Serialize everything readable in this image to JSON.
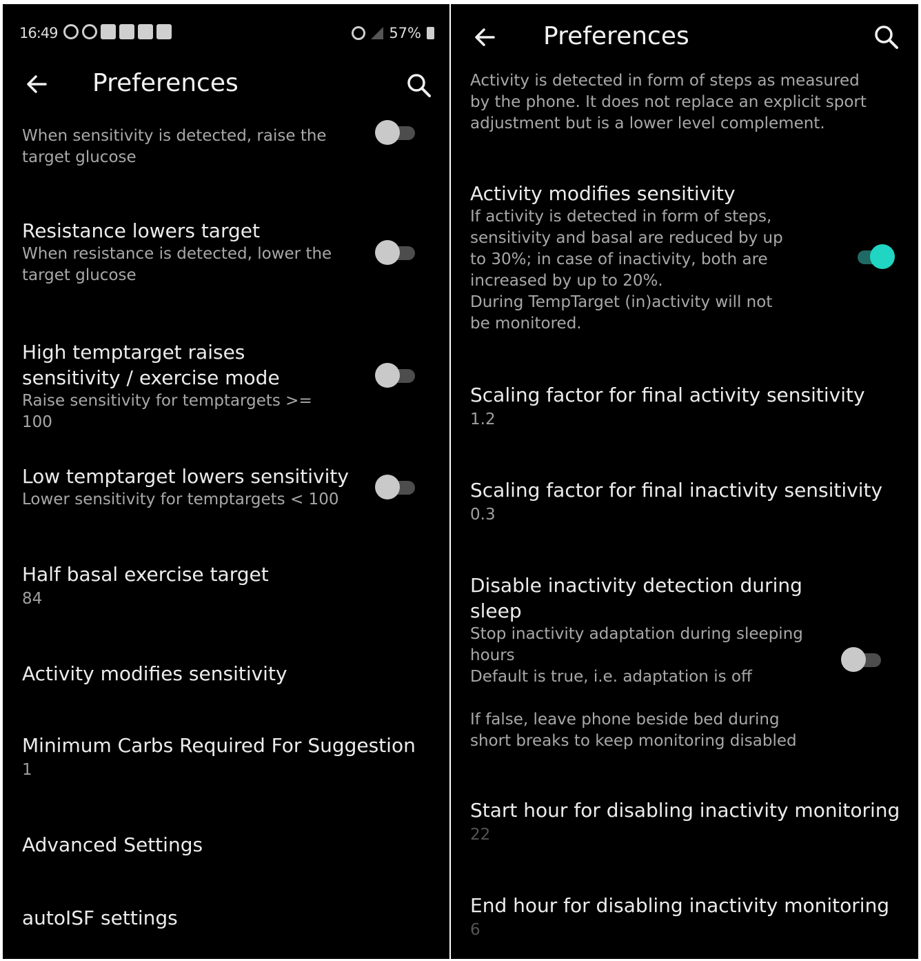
{
  "statusbar": {
    "time": "16:49",
    "battery": "57%"
  },
  "left": {
    "title": "Preferences",
    "items": [
      {
        "subtitle": "When sensitivity is detected, raise the target glucose",
        "toggle": false
      },
      {
        "title": "Resistance lowers target",
        "subtitle": "When resistance is detected, lower the target glucose",
        "toggle": false
      },
      {
        "title": "High temptarget raises sensitivity / exercise mode",
        "subtitle": "Raise sensitivity for temptargets >= 100",
        "toggle": false
      },
      {
        "title": "Low temptarget lowers sensitivity",
        "subtitle": "Lower sensitivity for temptargets < 100",
        "toggle": false
      },
      {
        "title": "Half basal exercise target",
        "value": "84"
      },
      {
        "title": "Activity modifies sensitivity"
      },
      {
        "title": "Minimum Carbs Required For Suggestion",
        "value": "1"
      },
      {
        "title": "Advanced Settings"
      },
      {
        "title": "autoISF settings"
      }
    ]
  },
  "right": {
    "title": "Preferences",
    "intro": "Activity is detected in form of steps as measured by the phone. It does not replace an explicit sport adjustment but is a lower level complement.",
    "items": [
      {
        "title": "Activity modifies sensitivity",
        "subtitle": "If activity is detected in form of steps, sensitivity and basal are reduced by up to 30%; in case of inactivity, both are increased by up to 20%.",
        "subtitle2": "During TempTarget (in)activity will not be monitored.",
        "toggle": true
      },
      {
        "title": "Scaling factor for final activity sensitivity",
        "value": "1.2"
      },
      {
        "title": "Scaling factor for final inactivity sensitivity",
        "value": "0.3"
      },
      {
        "title": "Disable inactivity detection during sleep",
        "subtitle": "Stop inactivity adaptation during sleeping hours",
        "subtitle2": "Default is true, i.e. adaptation is off",
        "subtitle3": "If false, leave phone beside bed during short breaks to keep monitoring disabled",
        "toggle": false
      },
      {
        "title": "Start hour for disabling inactivity monitoring",
        "value": "22"
      },
      {
        "title": "End hour for disabling inactivity monitoring",
        "value": "6"
      }
    ]
  },
  "colors": {
    "background": "#000000",
    "accent": "#20d6c2",
    "text": "#ececec",
    "secondary": "#a8a8a8"
  },
  "icons": {
    "back": "arrow-left-icon",
    "search": "search-icon"
  }
}
